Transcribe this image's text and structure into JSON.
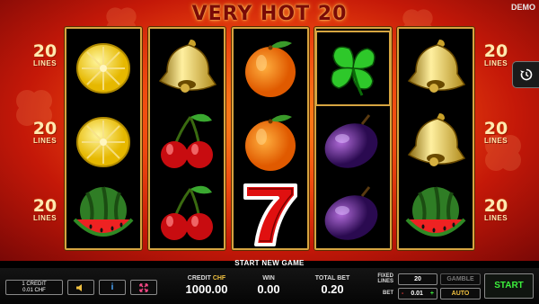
{
  "game": {
    "title": "VERY HOT 20",
    "mode_badge": "DEMO",
    "lines_count": "20",
    "lines_word": "LINES",
    "message": "START NEW GAME"
  },
  "reels": [
    [
      "lemon",
      "lemon",
      "watermelon"
    ],
    [
      "bell",
      "cherry",
      "cherry"
    ],
    [
      "orange",
      "orange",
      "seven"
    ],
    [
      "clover",
      "plum",
      "plum"
    ],
    [
      "bell",
      "bell",
      "watermelon"
    ]
  ],
  "highlighted_cell": {
    "reel": 4,
    "row": 1
  },
  "side_button": {
    "icon": "history-icon"
  },
  "bottom_bar": {
    "credit_info_line1": "1 CREDIT",
    "credit_info_line2": "0.01 CHF",
    "sound_icon": "speaker-icon",
    "info_label": "i",
    "fullscreen_icon": "fullscreen-icon",
    "credit_label": "CREDIT",
    "credit_currency": "CHF",
    "credit_value": "1000.00",
    "win_label": "WIN",
    "win_value": "0.00",
    "total_bet_label": "TOTAL BET",
    "total_bet_value": "0.20",
    "fixed_lines_label_1": "FIXED",
    "fixed_lines_label_2": "LINES",
    "fixed_lines_value": "20",
    "bet_label": "BET",
    "bet_minus": "-",
    "bet_value": "0.01",
    "bet_plus": "+",
    "gamble_label": "GAMBLE",
    "auto_label": "AUTO",
    "start_label": "START"
  },
  "colors": {
    "frame_gold": "#d6a440",
    "background_red": "#c41808",
    "start_green": "#3cf03c",
    "auto_yellow": "#f0c040"
  }
}
